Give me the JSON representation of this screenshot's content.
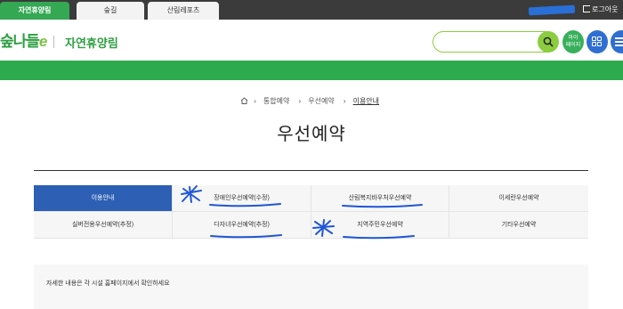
{
  "topbar": {
    "tabs": [
      "자연휴양림",
      "숲길",
      "산림레포츠"
    ],
    "logout": "로그아웃"
  },
  "header": {
    "logo": "숲나들e",
    "brand": "자연휴양림",
    "search_value": "",
    "my_page": "마이\n페이지"
  },
  "breadcrumb": [
    "통합예약",
    "우선예약",
    "이용안내"
  ],
  "page_title": "우선예약",
  "tabs": [
    "이용안내",
    "장애인우선예약(수정)",
    "산림복지바우처우선예약",
    "이세란우선예약",
    "실버전용우선예약(추정)",
    "다자녀우선예약(추정)",
    "지역주민우선예약",
    "기타우선예약"
  ],
  "notice": "자세한 내용은 각 시설 홈페이지에서 확인하세요",
  "colors": {
    "green": "#2eaa4e",
    "lime": "#8ccc3f",
    "blue": "#2d5fb4",
    "annotation_blue": "#1f56d6"
  }
}
